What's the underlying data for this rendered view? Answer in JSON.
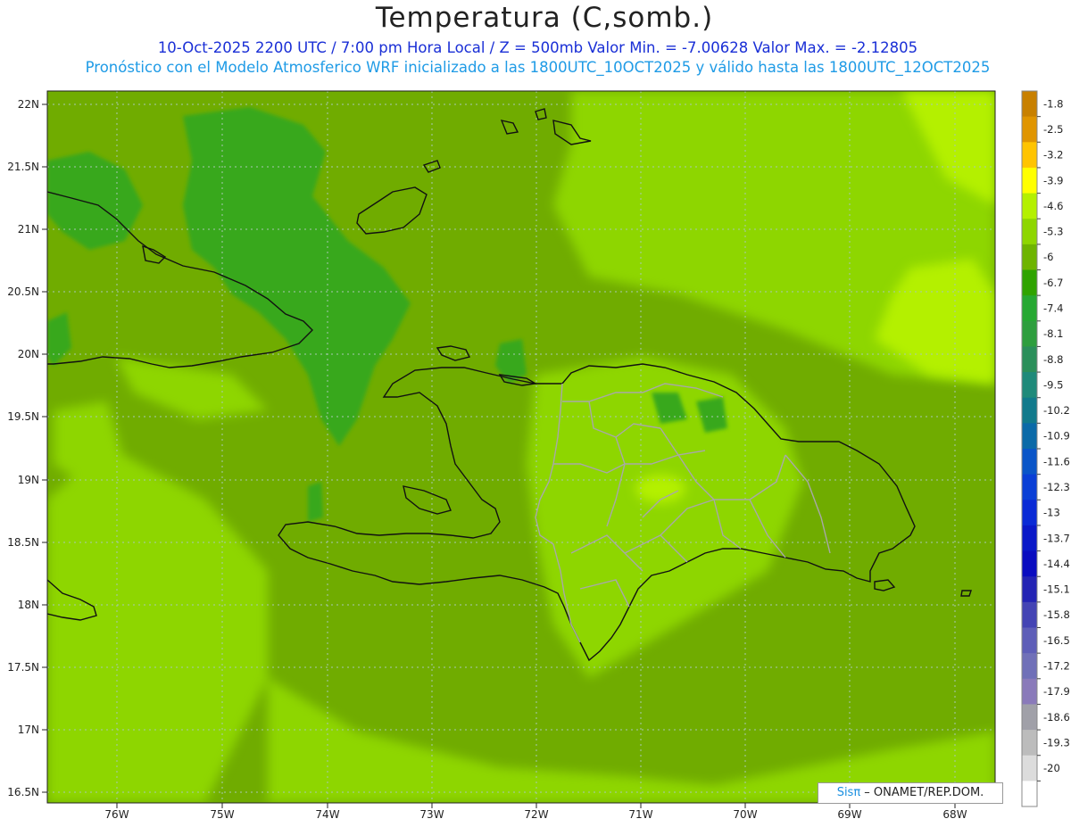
{
  "title": "Temperatura (C,somb.)",
  "subtitle_line1": "10-Oct-2025  2200 UTC / 7:00 pm Hora Local / Z = 500mb  Valor Min. = -7.00628  Valor Max. = -2.12805",
  "subtitle_line2": "Pronóstico con el Modelo Atmosferico WRF inicializado a las 1800UTC_10OCT2025 y válido hasta las  1800UTC_12OCT2025",
  "credit": {
    "sis": "Sisπ",
    "rest": " – ONAMET/REP.DOM."
  },
  "lat_labels": [
    "22N",
    "21.5N",
    "21N",
    "20.5N",
    "20N",
    "19.5N",
    "19N",
    "18.5N",
    "18N",
    "17.5N",
    "17N",
    "16.5N"
  ],
  "lon_labels": [
    "76W",
    "75W",
    "74W",
    "73W",
    "72W",
    "71W",
    "70W",
    "69W",
    "68W"
  ],
  "colorbar": {
    "labels": [
      "-1.8",
      "-2.5",
      "-3.2",
      "-3.9",
      "-4.6",
      "-5.3",
      "-6",
      "-6.7",
      "-7.4",
      "-8.1",
      "-8.8",
      "-9.5",
      "-10.2",
      "-10.9",
      "-11.6",
      "-12.3",
      "-13",
      "-13.7",
      "-14.4",
      "-15.1",
      "-15.8",
      "-16.5",
      "-17.2",
      "-17.9",
      "-18.6",
      "-19.3",
      "-20"
    ],
    "colors": [
      "#c88000",
      "#e09500",
      "#ffc400",
      "#ffff00",
      "#b4f000",
      "#8ed600",
      "#6eb400",
      "#2fa300",
      "#26a832",
      "#2e9e3e",
      "#2b8f5a",
      "#1f8a7a",
      "#117a8c",
      "#0b6aa8",
      "#0a55c8",
      "#0a3fd6",
      "#0a2ad6",
      "#0a18c8",
      "#0a0cc0",
      "#2424b4",
      "#4444b4",
      "#5e5eb8",
      "#7070b8",
      "#8a7aba",
      "#a0a0a8",
      "#bcbcbc",
      "#dcdcdc",
      "#ffffff"
    ]
  }
}
